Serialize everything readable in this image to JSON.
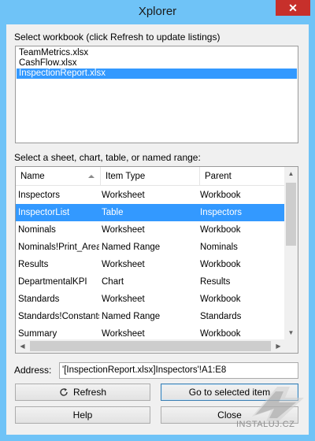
{
  "window": {
    "title": "Xplorer",
    "close_glyph": "✕"
  },
  "workbooks": {
    "label": "Select workbook (click Refresh to update listings)",
    "items": [
      "TeamMetrics.xlsx",
      "CashFlow.xlsx",
      "InspectionReport.xlsx"
    ],
    "selected_index": 2
  },
  "sheets": {
    "label": "Select a sheet, chart, table, or named range:",
    "columns": [
      "Name",
      "Item Type",
      "Parent"
    ],
    "sort_column": "Name",
    "rows": [
      {
        "name": "Inspectors",
        "type": "Worksheet",
        "parent": "Workbook"
      },
      {
        "name": "InspectorList",
        "type": "Table",
        "parent": "Inspectors"
      },
      {
        "name": "Nominals",
        "type": "Worksheet",
        "parent": "Workbook"
      },
      {
        "name": "Nominals!Print_Area",
        "type": "Named Range",
        "parent": "Nominals"
      },
      {
        "name": "Results",
        "type": "Worksheet",
        "parent": "Workbook"
      },
      {
        "name": "DepartmentalKPI",
        "type": "Chart",
        "parent": "Results"
      },
      {
        "name": "Standards",
        "type": "Worksheet",
        "parent": "Workbook"
      },
      {
        "name": "Standards!Constants",
        "type": "Named Range",
        "parent": "Standards"
      },
      {
        "name": "Summary",
        "type": "Worksheet",
        "parent": "Workbook"
      }
    ],
    "selected_index": 1
  },
  "address": {
    "label": "Address:",
    "value": "'[InspectionReport.xlsx]Inspectors'!A1:E8"
  },
  "buttons": {
    "refresh": "Refresh",
    "goto": "Go to selected item",
    "help": "Help",
    "close": "Close"
  },
  "watermark": {
    "text": "INSTALUJ.CZ"
  },
  "colors": {
    "title_bar": "#6fc3f7",
    "selection": "#3399ff",
    "close_button": "#c7302b"
  }
}
